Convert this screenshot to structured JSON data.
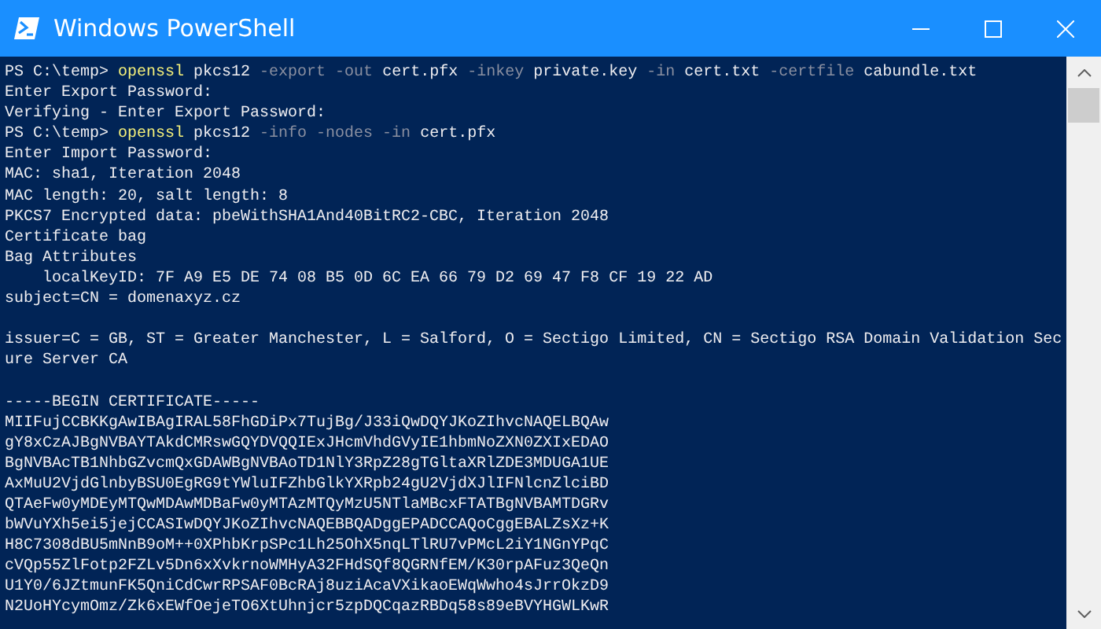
{
  "window": {
    "title": "Windows PowerShell"
  },
  "console": {
    "lines": [
      {
        "kind": "command",
        "segments": [
          {
            "kind": "prompt",
            "text": "PS C:\\temp> "
          },
          {
            "kind": "cmd",
            "text": "openssl"
          },
          {
            "kind": "arg",
            "text": " pkcs12 "
          },
          {
            "kind": "param",
            "text": "-export -out"
          },
          {
            "kind": "arg",
            "text": " cert.pfx "
          },
          {
            "kind": "param",
            "text": "-inkey"
          },
          {
            "kind": "arg",
            "text": " private.key "
          },
          {
            "kind": "param",
            "text": "-in"
          },
          {
            "kind": "arg",
            "text": " cert.txt "
          },
          {
            "kind": "param",
            "text": "-certfile"
          },
          {
            "kind": "arg",
            "text": " cabundle.txt"
          }
        ]
      },
      {
        "kind": "output",
        "text": "Enter Export Password:"
      },
      {
        "kind": "output",
        "text": "Verifying - Enter Export Password:"
      },
      {
        "kind": "command",
        "segments": [
          {
            "kind": "prompt",
            "text": "PS C:\\temp> "
          },
          {
            "kind": "cmd",
            "text": "openssl"
          },
          {
            "kind": "arg",
            "text": " pkcs12 "
          },
          {
            "kind": "param",
            "text": "-info -nodes -in"
          },
          {
            "kind": "arg",
            "text": " cert.pfx"
          }
        ]
      },
      {
        "kind": "output",
        "text": "Enter Import Password:"
      },
      {
        "kind": "output",
        "text": "MAC: sha1, Iteration 2048"
      },
      {
        "kind": "output",
        "text": "MAC length: 20, salt length: 8"
      },
      {
        "kind": "output",
        "text": "PKCS7 Encrypted data: pbeWithSHA1And40BitRC2-CBC, Iteration 2048"
      },
      {
        "kind": "output",
        "text": "Certificate bag"
      },
      {
        "kind": "output",
        "text": "Bag Attributes"
      },
      {
        "kind": "output",
        "text": "    localKeyID: 7F A9 E5 DE 74 08 B5 0D 6C EA 66 79 D2 69 47 F8 CF 19 22 AD"
      },
      {
        "kind": "output",
        "text": "subject=CN = domenaxyz.cz"
      },
      {
        "kind": "blank"
      },
      {
        "kind": "output",
        "text": "issuer=C = GB, ST = Greater Manchester, L = Salford, O = Sectigo Limited, CN = Sectigo RSA Domain Validation Sec"
      },
      {
        "kind": "output",
        "text": "ure Server CA"
      },
      {
        "kind": "blank"
      },
      {
        "kind": "output",
        "text": "-----BEGIN CERTIFICATE-----"
      },
      {
        "kind": "output",
        "text": "MIIFujCCBKKgAwIBAgIRAL58FhGDiPx7TujBg/J33iQwDQYJKoZIhvcNAQELBQAw"
      },
      {
        "kind": "output",
        "text": "gY8xCzAJBgNVBAYTAkdCMRswGQYDVQQIExJHcmVhdGVyIE1hbmNoZXN0ZXIxEDAO"
      },
      {
        "kind": "output",
        "text": "BgNVBAcTB1NhbGZvcmQxGDAWBgNVBAoTD1NlY3RpZ28gTGltaXRlZDE3MDUGA1UE"
      },
      {
        "kind": "output",
        "text": "AxMuU2VjdGlnbyBSU0EgRG9tYWluIFZhbGlkYXRpb24gU2VjdXJlIFNlcnZlciBD"
      },
      {
        "kind": "output",
        "text": "QTAeFw0yMDEyMTQwMDAwMDBaFw0yMTAzMTQyMzU5NTlaMBcxFTATBgNVBAMTDGRv"
      },
      {
        "kind": "output",
        "text": "bWVuYXh5ei5jejCCASIwDQYJKoZIhvcNAQEBBQADggEPADCCAQoCggEBALZsXz+K"
      },
      {
        "kind": "output",
        "text": "H8C7308dBU5mNnB9oM++0XPhbKrpSPc1Lh25OhX5nqLTlRU7vPMcL2iY1NGnYPqC"
      },
      {
        "kind": "output",
        "text": "cVQp55ZlFotp2FZLv5Dn6xXvkrnoWMHyA32FHdSQf8QGRNfEM/K30rpAFuz3QeQn"
      },
      {
        "kind": "output",
        "text": "U1Y0/6JZtmunFK5QniCdCwrRPSAF0BcRAj8uziAcaVXikaoEWqWwho4sJrrOkzD9"
      },
      {
        "kind": "output",
        "text": "N2UoHYcymOmz/Zk6xEWfOejeTO6XtUhnjcr5zpDQCqazRBDq58s89eBVYHGWLKwR"
      }
    ]
  }
}
